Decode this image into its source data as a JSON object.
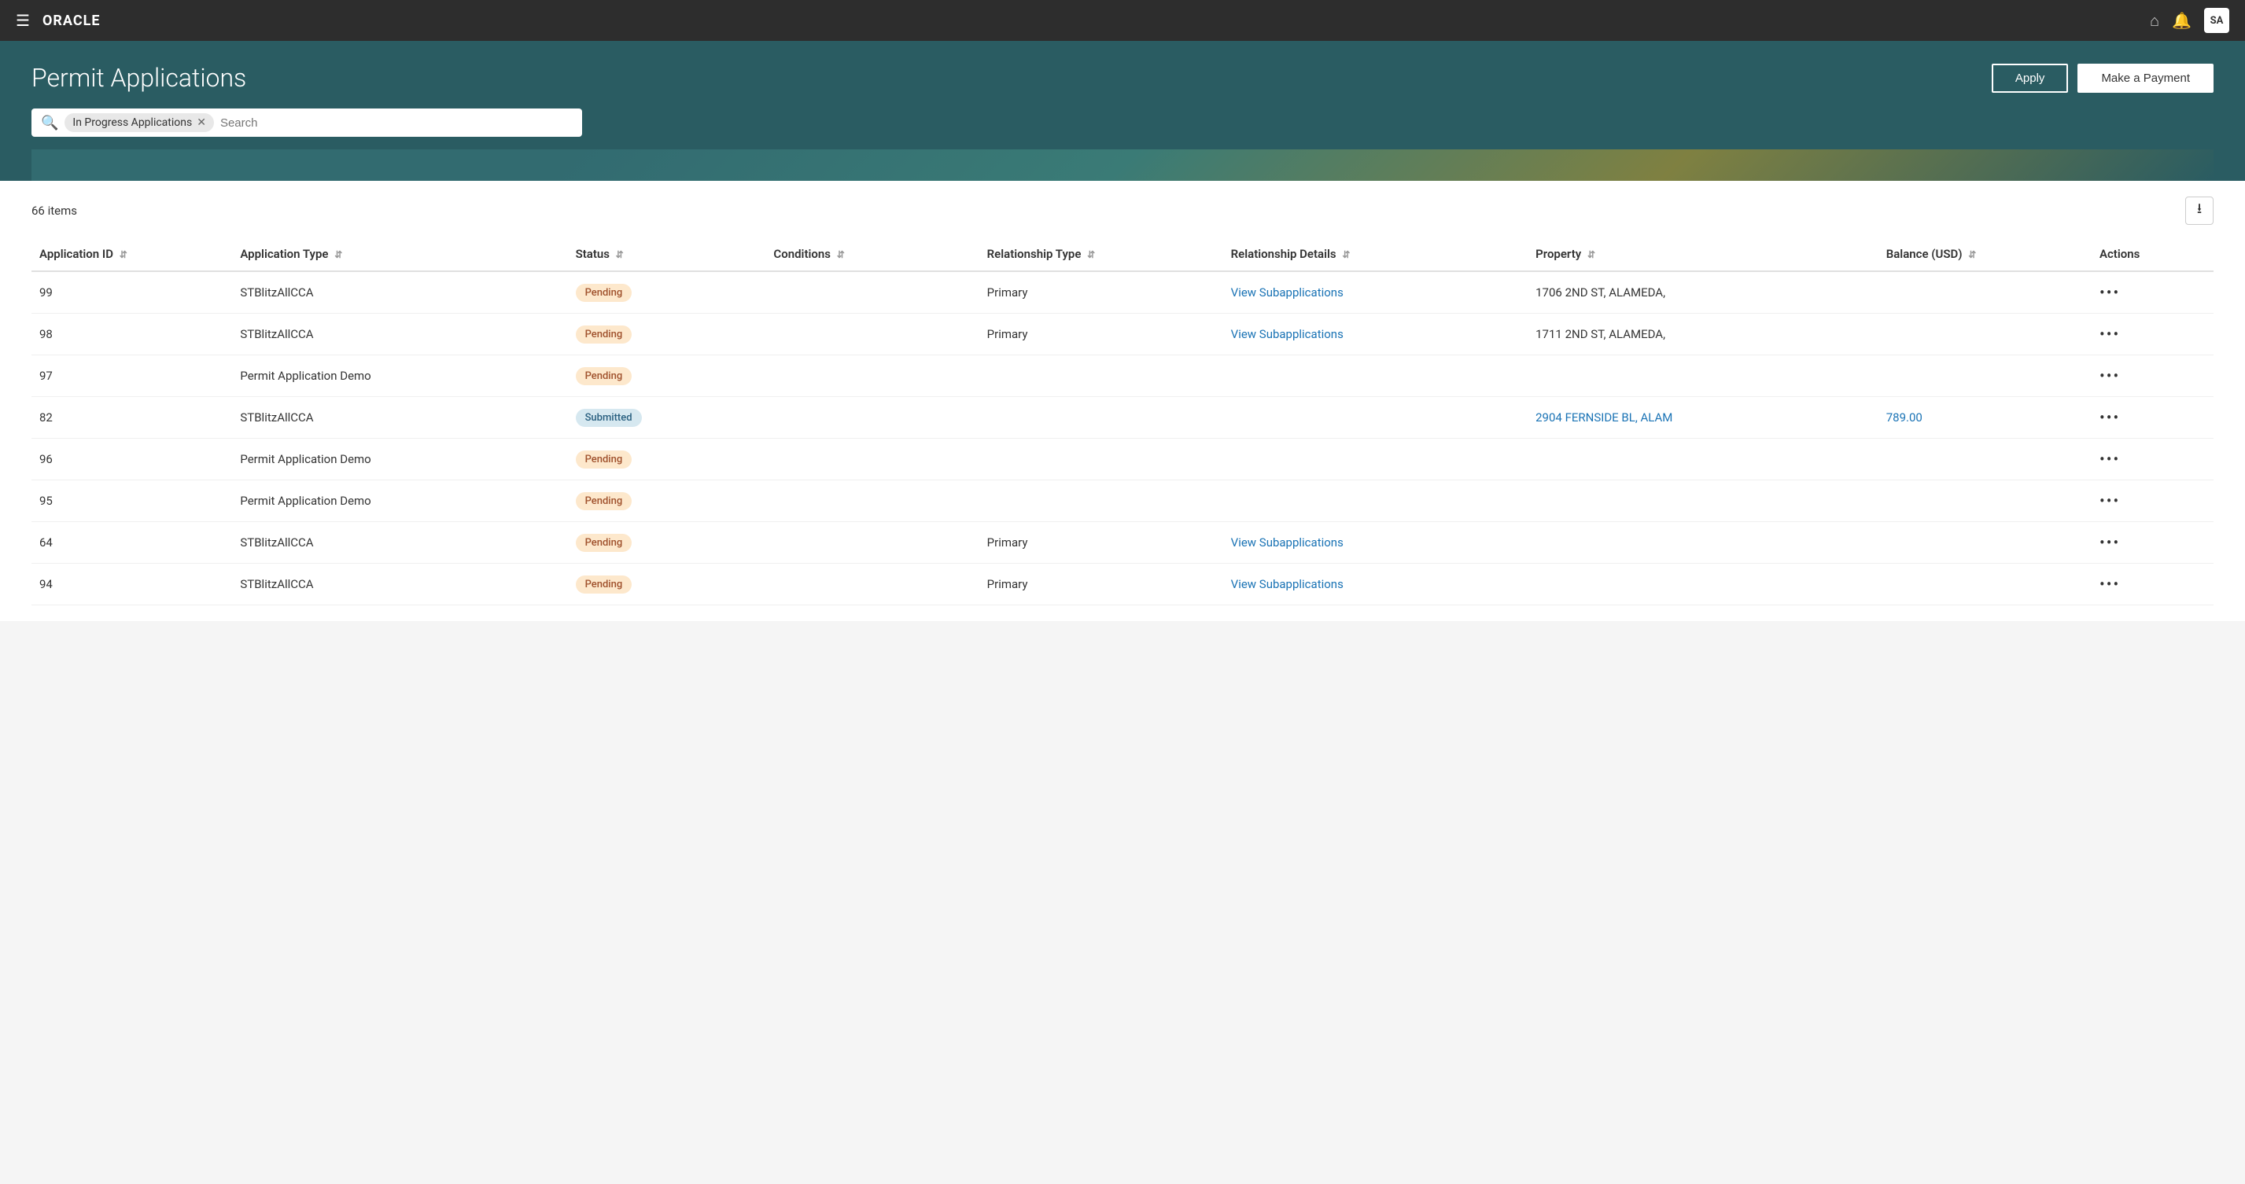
{
  "nav": {
    "logo": "ORACLE",
    "user_initials": "SA"
  },
  "header": {
    "title": "Permit Applications",
    "apply_label": "Apply",
    "make_payment_label": "Make a Payment",
    "search_filter": "In Progress Applications",
    "search_placeholder": "Search"
  },
  "table": {
    "items_count": "66 items",
    "columns": {
      "application_id": "Application ID",
      "application_type": "Application Type",
      "status": "Status",
      "conditions": "Conditions",
      "relationship_type": "Relationship Type",
      "relationship_details": "Relationship Details",
      "property": "Property",
      "balance": "Balance (USD)",
      "actions": "Actions"
    },
    "rows": [
      {
        "id": "99",
        "type": "STBlitzAllCCA",
        "status": "Pending",
        "status_class": "pending",
        "conditions": "",
        "rel_type": "Primary",
        "rel_details": "View Subapplications",
        "property": "1706 2ND ST, ALAMEDA,",
        "balance": "",
        "has_property_link": false
      },
      {
        "id": "98",
        "type": "STBlitzAllCCA",
        "status": "Pending",
        "status_class": "pending",
        "conditions": "",
        "rel_type": "Primary",
        "rel_details": "View Subapplications",
        "property": "1711 2ND ST, ALAMEDA,",
        "balance": "",
        "has_property_link": false
      },
      {
        "id": "97",
        "type": "Permit Application Demo",
        "status": "Pending",
        "status_class": "pending",
        "conditions": "",
        "rel_type": "",
        "rel_details": "",
        "property": "",
        "balance": "",
        "has_property_link": false
      },
      {
        "id": "82",
        "type": "STBlitzAllCCA",
        "status": "Submitted",
        "status_class": "submitted",
        "conditions": "",
        "rel_type": "",
        "rel_details": "",
        "property": "2904 FERNSIDE BL, ALAM",
        "balance": "789.00",
        "has_property_link": true
      },
      {
        "id": "96",
        "type": "Permit Application Demo",
        "status": "Pending",
        "status_class": "pending",
        "conditions": "",
        "rel_type": "",
        "rel_details": "",
        "property": "",
        "balance": "",
        "has_property_link": false
      },
      {
        "id": "95",
        "type": "Permit Application Demo",
        "status": "Pending",
        "status_class": "pending",
        "conditions": "",
        "rel_type": "",
        "rel_details": "",
        "property": "",
        "balance": "",
        "has_property_link": false
      },
      {
        "id": "64",
        "type": "STBlitzAllCCA",
        "status": "Pending",
        "status_class": "pending",
        "conditions": "",
        "rel_type": "Primary",
        "rel_details": "View Subapplications",
        "property": "",
        "balance": "",
        "has_property_link": false
      },
      {
        "id": "94",
        "type": "STBlitzAllCCA",
        "status": "Pending",
        "status_class": "pending",
        "conditions": "",
        "rel_type": "Primary",
        "rel_details": "View Subapplications",
        "property": "",
        "balance": "",
        "has_property_link": false
      }
    ]
  }
}
